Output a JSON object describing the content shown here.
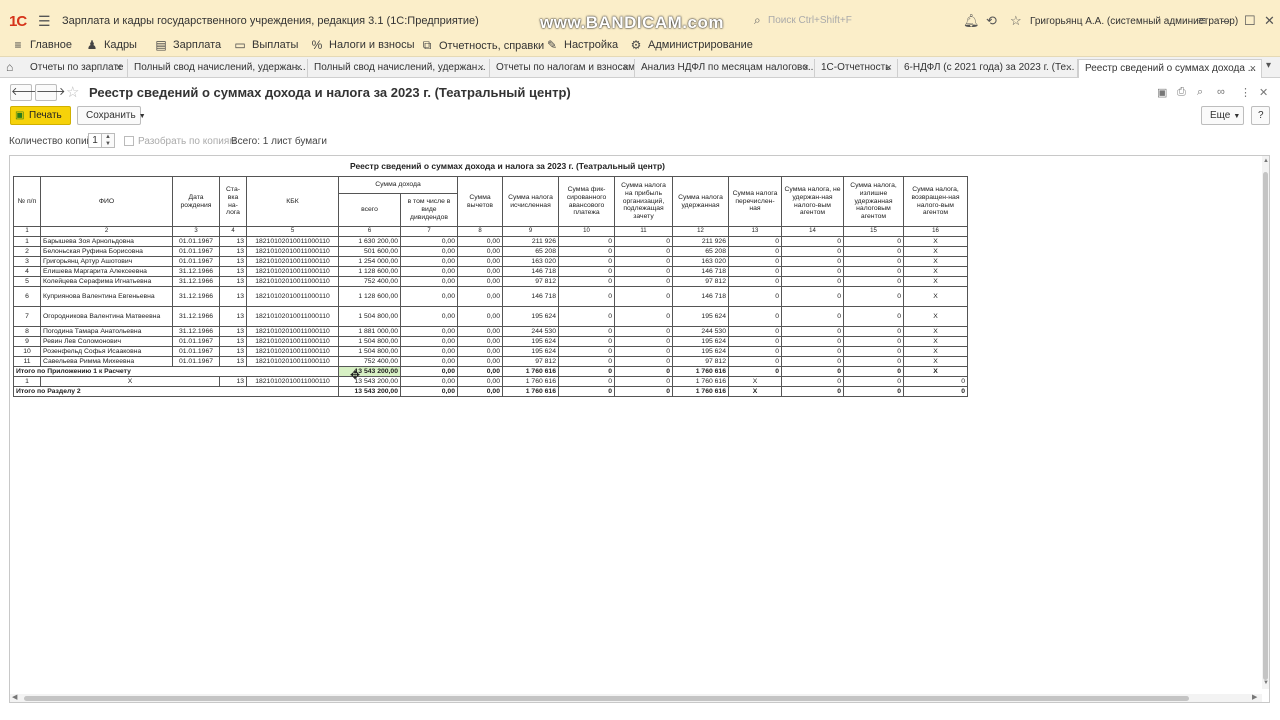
{
  "window": {
    "title": "Зарплата и кадры государственного учреждения, редакция 3.1  (1С:Предприятие)",
    "watermark": "www.BANDICAM.com",
    "search_placeholder": "Поиск Ctrl+Shift+F",
    "user": "Григорьянц А.А. (системный администратор)"
  },
  "menu": [
    {
      "label": "Главное",
      "icon": "≡"
    },
    {
      "label": "Кадры",
      "icon": "♟"
    },
    {
      "label": "Зарплата",
      "icon": "▤"
    },
    {
      "label": "Выплаты",
      "icon": "▭"
    },
    {
      "label": "Налоги и взносы",
      "icon": "%"
    },
    {
      "label": "Отчетность, справки",
      "icon": "⧉"
    },
    {
      "label": "Настройка",
      "icon": "✎"
    },
    {
      "label": "Администрирование",
      "icon": "⚙"
    }
  ],
  "tabs": [
    {
      "label": "Отчеты по зарплате"
    },
    {
      "label": "Полный свод начислений, удержан..."
    },
    {
      "label": "Полный свод начислений, удержан..."
    },
    {
      "label": "Отчеты по налогам и взносам"
    },
    {
      "label": "Анализ НДФЛ по месяцам налогово..."
    },
    {
      "label": "1С-Отчетность"
    },
    {
      "label": "6-НДФЛ (с 2021 года) за 2023 г. (Те..."
    },
    {
      "label": "Реестр сведений о суммах дохода ..."
    }
  ],
  "form": {
    "title": "Реестр сведений о суммах дохода и налога за 2023 г. (Театральный центр)",
    "print_label": "Печать",
    "save_label": "Сохранить",
    "more_label": "Еще",
    "help_label": "?",
    "copies_label": "Количество копий:",
    "copies_value": "1",
    "collate_label": "Разобрать по копиям",
    "total_label": "Всего: 1 лист бумаги"
  },
  "report": {
    "title": "Реестр сведений о суммах дохода и налога за 2023 г. (Театральный центр)",
    "headers": {
      "num": "№ п/п",
      "fio": "ФИО",
      "dob": "Дата рождения",
      "rate": "Ста-вка на-лога",
      "kbk": "КБК",
      "income": "Сумма дохода",
      "income_total": "всего",
      "income_div": "в том числе в виде дивидендов",
      "deductions": "Сумма вычетов",
      "tax_calc": "Сумма налога исчисленная",
      "fixed_adv": "Сумма фик-сированного авансового платежа",
      "profit_tax": "Сумма налога на прибыль организаций, подлежащая зачету",
      "tax_withheld": "Сумма налога удержанная",
      "tax_transferred": "Сумма налога перечислен-ная",
      "not_withheld": "Сумма налога, не удержан-ная налого-вым агентом",
      "over_withheld": "Сумма налога, излишне удержанная налоговым агентом",
      "refunded": "Сумма налога, возвращен-ная налого-вым агентом"
    },
    "col_numbers": [
      "1",
      "2",
      "3",
      "4",
      "5",
      "6",
      "7",
      "8",
      "9",
      "10",
      "11",
      "12",
      "13",
      "14",
      "15",
      "16"
    ],
    "rows": [
      {
        "n": "1",
        "fio": "Барышева Зоя Арнольдовна",
        "dob": "01.01.1967",
        "rate": "13",
        "kbk": "18210102010011000110",
        "total": "1 630 200,00",
        "div": "0,00",
        "ded": "0,00",
        "calc": "211 926",
        "fix": "0",
        "profit": "0",
        "withheld": "211 926",
        "transf": "0",
        "notw": "0",
        "over": "0",
        "ref": "X"
      },
      {
        "n": "2",
        "fio": "Белоньская Руфина Борисовна",
        "dob": "01.01.1967",
        "rate": "13",
        "kbk": "18210102010011000110",
        "total": "501 600,00",
        "div": "0,00",
        "ded": "0,00",
        "calc": "65 208",
        "fix": "0",
        "profit": "0",
        "withheld": "65 208",
        "transf": "0",
        "notw": "0",
        "over": "0",
        "ref": "X"
      },
      {
        "n": "3",
        "fio": "Григорьянц Артур Ашотович",
        "dob": "01.01.1967",
        "rate": "13",
        "kbk": "18210102010011000110",
        "total": "1 254 000,00",
        "div": "0,00",
        "ded": "0,00",
        "calc": "163 020",
        "fix": "0",
        "profit": "0",
        "withheld": "163 020",
        "transf": "0",
        "notw": "0",
        "over": "0",
        "ref": "X"
      },
      {
        "n": "4",
        "fio": "Елишева Маргарита Алексеевна",
        "dob": "31.12.1966",
        "rate": "13",
        "kbk": "18210102010011000110",
        "total": "1 128 600,00",
        "div": "0,00",
        "ded": "0,00",
        "calc": "146 718",
        "fix": "0",
        "profit": "0",
        "withheld": "146 718",
        "transf": "0",
        "notw": "0",
        "over": "0",
        "ref": "X"
      },
      {
        "n": "5",
        "fio": "Колейцева Серафима Игнатьевна",
        "dob": "31.12.1966",
        "rate": "13",
        "kbk": "18210102010011000110",
        "total": "752 400,00",
        "div": "0,00",
        "ded": "0,00",
        "calc": "97 812",
        "fix": "0",
        "profit": "0",
        "withheld": "97 812",
        "transf": "0",
        "notw": "0",
        "over": "0",
        "ref": "X"
      },
      {
        "n": "6",
        "fio": "Куприянова Валентина Евгеньевна",
        "dob": "31.12.1966",
        "rate": "13",
        "kbk": "18210102010011000110",
        "total": "1 128 600,00",
        "div": "0,00",
        "ded": "0,00",
        "calc": "146 718",
        "fix": "0",
        "profit": "0",
        "withheld": "146 718",
        "transf": "0",
        "notw": "0",
        "over": "0",
        "ref": "X",
        "tall": true
      },
      {
        "n": "7",
        "fio": "Огородникова Валентина Матвеевна",
        "dob": "31.12.1966",
        "rate": "13",
        "kbk": "18210102010011000110",
        "total": "1 504 800,00",
        "div": "0,00",
        "ded": "0,00",
        "calc": "195 624",
        "fix": "0",
        "profit": "0",
        "withheld": "195 624",
        "transf": "0",
        "notw": "0",
        "over": "0",
        "ref": "X",
        "tall": true
      },
      {
        "n": "8",
        "fio": "Погодина Тамара Анатольевна",
        "dob": "31.12.1966",
        "rate": "13",
        "kbk": "18210102010011000110",
        "total": "1 881 000,00",
        "div": "0,00",
        "ded": "0,00",
        "calc": "244 530",
        "fix": "0",
        "profit": "0",
        "withheld": "244 530",
        "transf": "0",
        "notw": "0",
        "over": "0",
        "ref": "X"
      },
      {
        "n": "9",
        "fio": "Ревин Лев Соломонович",
        "dob": "01.01.1967",
        "rate": "13",
        "kbk": "18210102010011000110",
        "total": "1 504 800,00",
        "div": "0,00",
        "ded": "0,00",
        "calc": "195 624",
        "fix": "0",
        "profit": "0",
        "withheld": "195 624",
        "transf": "0",
        "notw": "0",
        "over": "0",
        "ref": "X"
      },
      {
        "n": "10",
        "fio": "Розенфельд Софья Исааковна",
        "dob": "01.01.1967",
        "rate": "13",
        "kbk": "18210102010011000110",
        "total": "1 504 800,00",
        "div": "0,00",
        "ded": "0,00",
        "calc": "195 624",
        "fix": "0",
        "profit": "0",
        "withheld": "195 624",
        "transf": "0",
        "notw": "0",
        "over": "0",
        "ref": "X"
      },
      {
        "n": "11",
        "fio": "Савельева Римма Михеевна",
        "dob": "01.01.1967",
        "rate": "13",
        "kbk": "18210102010011000110",
        "total": "752 400,00",
        "div": "0,00",
        "ded": "0,00",
        "calc": "97 812",
        "fix": "0",
        "profit": "0",
        "withheld": "97 812",
        "transf": "0",
        "notw": "0",
        "over": "0",
        "ref": "X"
      }
    ],
    "total_app": {
      "label": "Итого по Приложению 1 к Расчету",
      "total": "13 543 200,00",
      "div": "0,00",
      "ded": "0,00",
      "calc": "1 760 616",
      "fix": "0",
      "profit": "0",
      "withheld": "1 760 616",
      "transf": "0",
      "notw": "0",
      "over": "0",
      "ref": "X"
    },
    "section_row": {
      "n": "1",
      "fio": "X",
      "rate": "13",
      "kbk": "18210102010011000110",
      "total": "13 543 200,00",
      "div": "0,00",
      "ded": "0,00",
      "calc": "1 760 616",
      "fix": "0",
      "profit": "0",
      "withheld": "1 760 616",
      "transf": "X",
      "notw": "0",
      "over": "0",
      "ref": "0"
    },
    "total_section": {
      "label": "Итого по Разделу 2",
      "total": "13 543 200,00",
      "div": "0,00",
      "ded": "0,00",
      "calc": "1 760 616",
      "fix": "0",
      "profit": "0",
      "withheld": "1 760 616",
      "transf": "X",
      "notw": "0",
      "over": "0",
      "ref": "0"
    }
  }
}
